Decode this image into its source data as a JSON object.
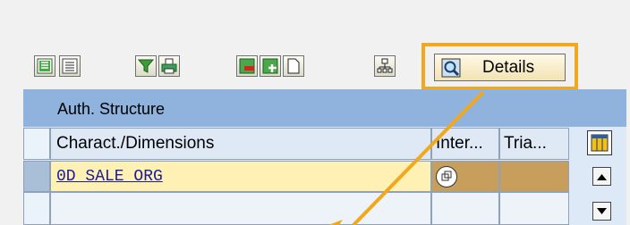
{
  "toolbar": {
    "details_label": "Details",
    "icons": [
      "select-all-icon",
      "deselect-all-icon",
      "filter-icon",
      "print-icon",
      "delete-row-icon",
      "insert-row-icon",
      "new-document-icon",
      "hierarchy-icon",
      "details-icon"
    ]
  },
  "table": {
    "title": "Auth. Structure",
    "columns": [
      "Charact./Dimensions",
      "Inter...",
      "Tria..."
    ],
    "rows": [
      {
        "characteristic": "0D_SALE_ORG",
        "interval": "",
        "trial": ""
      },
      {
        "characteristic": "",
        "interval": "",
        "trial": ""
      }
    ]
  },
  "colors": {
    "title_bar": "#8fb3dd",
    "highlight": "#f2a81d",
    "selected_row": "#fff0b3"
  }
}
